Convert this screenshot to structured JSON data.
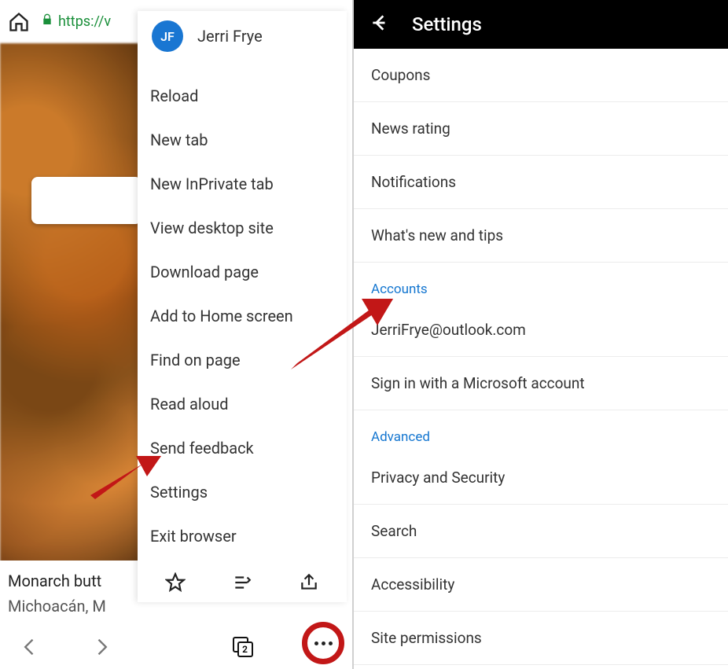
{
  "left": {
    "url_protocol": "https://v",
    "user_initials": "JF",
    "user_name": "Jerri Frye",
    "menu_items": [
      "Reload",
      "New tab",
      "New InPrivate tab",
      "View desktop site",
      "Download page",
      "Add to Home screen",
      "Find on page",
      "Read aloud",
      "Send feedback",
      "Settings",
      "Exit browser"
    ],
    "caption_line1": "Monarch butt",
    "caption_line2": "Michoacán, M",
    "tabs_count": "2"
  },
  "right": {
    "title": "Settings",
    "items_top": [
      "Coupons",
      "News rating",
      "Notifications",
      "What's new and tips"
    ],
    "section_accounts": "Accounts",
    "account_email": "JerriFrye@outlook.com",
    "sign_in": "Sign in with a Microsoft account",
    "section_advanced": "Advanced",
    "items_advanced": [
      "Privacy and Security",
      "Search",
      "Accessibility",
      "Site permissions"
    ]
  }
}
